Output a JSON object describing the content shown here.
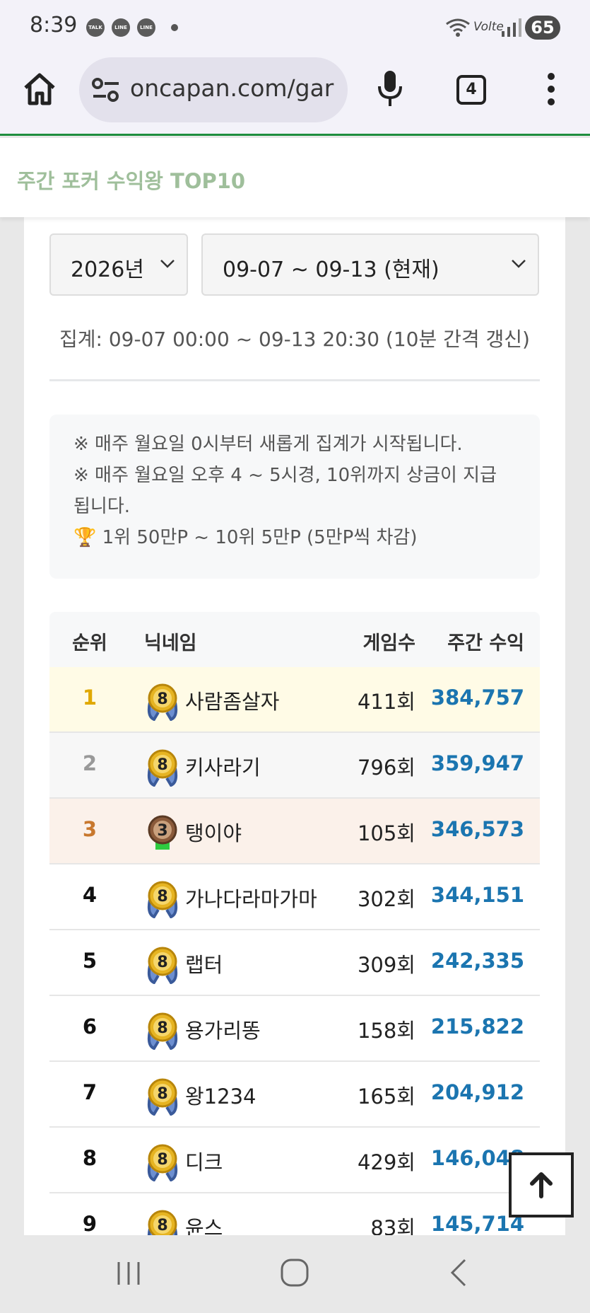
{
  "status_bar": {
    "time": "8:39",
    "notifications": [
      "TALK",
      "LINE",
      "LINE"
    ],
    "network": "Volte",
    "battery": "65"
  },
  "browser": {
    "url": "oncapan.com/gar",
    "tab_count": "4"
  },
  "page_header": {
    "title": "주간 포커 수익왕 TOP10"
  },
  "filters": {
    "year": "2026년",
    "week": "09-07 ~ 09-13 (현재)"
  },
  "range_text": "집계: 09-07 00:00 ~ 09-13 20:30 (10분 간격 갱신)",
  "notice": {
    "line1": "※ 매주 월요일 0시부터 새롭게 집계가 시작됩니다.",
    "line2": "※ 매주 월요일 오후 4 ~ 5시경, 10위까지 상금이 지급",
    "line3": "됩니다.",
    "line4": "🏆 1위 50만P ~ 10위 5만P (5만P씩 차감)"
  },
  "table": {
    "headers": {
      "rank": "순위",
      "nickname": "닉네임",
      "games": "게임수",
      "profit": "주간 수익"
    },
    "rows": [
      {
        "rank": "1",
        "level": "8",
        "nickname": "사람좀살자",
        "games": "411회",
        "profit": "384,757"
      },
      {
        "rank": "2",
        "level": "8",
        "nickname": "키사라기",
        "games": "796회",
        "profit": "359,947"
      },
      {
        "rank": "3",
        "level": "3",
        "nickname": "탱이야",
        "games": "105회",
        "profit": "346,573"
      },
      {
        "rank": "4",
        "level": "8",
        "nickname": "가나다라마가마",
        "games": "302회",
        "profit": "344,151"
      },
      {
        "rank": "5",
        "level": "8",
        "nickname": "랩터",
        "games": "309회",
        "profit": "242,335"
      },
      {
        "rank": "6",
        "level": "8",
        "nickname": "용가리똥",
        "games": "158회",
        "profit": "215,822"
      },
      {
        "rank": "7",
        "level": "8",
        "nickname": "왕1234",
        "games": "165회",
        "profit": "204,912"
      },
      {
        "rank": "8",
        "level": "8",
        "nickname": "디크",
        "games": "429회",
        "profit": "146,048"
      },
      {
        "rank": "9",
        "level": "8",
        "nickname": "윤스",
        "games": "83회",
        "profit": "145,714"
      }
    ]
  },
  "colors": {
    "accent_green": "#1e8e3e",
    "title_green": "#9fbf9b",
    "profit_blue": "#1b75b0",
    "rank1_bg": "#fffbe6",
    "rank2_bg": "#f7f7f7",
    "rank3_bg": "#fbf1ea",
    "rank1_text": "#e0a800",
    "rank2_text": "#999999",
    "rank3_text": "#c8782e"
  },
  "icons": {
    "home": "home-icon",
    "url_settings": "tune-icon",
    "mic": "mic-icon",
    "menu": "more-vert-icon",
    "scroll_top": "arrow-up-icon",
    "level_8": "gold-medal-icon",
    "level_3": "bronze-medal-icon"
  }
}
